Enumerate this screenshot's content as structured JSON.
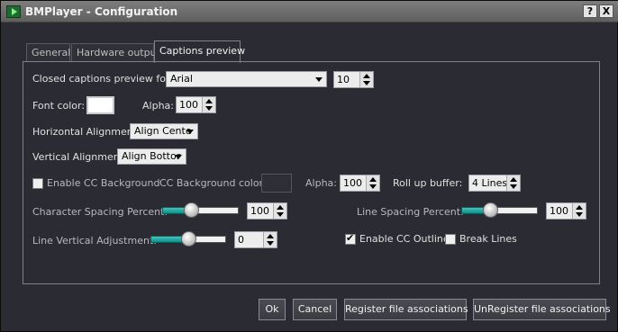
{
  "window": {
    "title": "BMPlayer - Configuration",
    "help_label": "?",
    "close_label": "X"
  },
  "tabs": [
    "General",
    "Hardware output",
    "Captions preview"
  ],
  "captions": {
    "font_label": "Closed captions preview font:",
    "font_value": "Arial",
    "font_size": "10",
    "font_color_label": "Font color:",
    "font_color": "#ffffff",
    "alpha_label": "Alpha:",
    "alpha_value": "100",
    "h_align_label": "Horizontal Alignment:",
    "h_align_value": "Align Cente",
    "v_align_label": "Vertical Alignment:",
    "v_align_value": "Align Bottor",
    "enable_bg_label": "Enable CC Background",
    "enable_bg_checked": false,
    "bg_color_label": "CC Background color:",
    "bg_alpha_label": "Alpha:",
    "bg_alpha_value": "100",
    "rollup_label": "Roll up buffer:",
    "rollup_value": "4 Lines",
    "char_spacing_label": "Character Spacing Percent:",
    "char_spacing_value": "100",
    "char_spacing_slider_level": 0.35,
    "line_spacing_label": "Line Spacing Percent:",
    "line_spacing_value": "100",
    "line_spacing_slider_level": 0.35,
    "line_vadj_label": "Line Vertical Adjustment:",
    "line_vadj_value": "0",
    "line_vadj_slider_level": 0.5,
    "enable_outline_label": "Enable CC Outline",
    "enable_outline_checked": true,
    "break_lines_label": "Break Lines",
    "break_lines_checked": false
  },
  "footer": {
    "ok": "Ok",
    "cancel": "Cancel",
    "register": "Register file associations",
    "unregister": "UnRegister file associations"
  },
  "colors": {
    "accent": "#1fa8a0",
    "panel_bg": "#2b2b33"
  }
}
